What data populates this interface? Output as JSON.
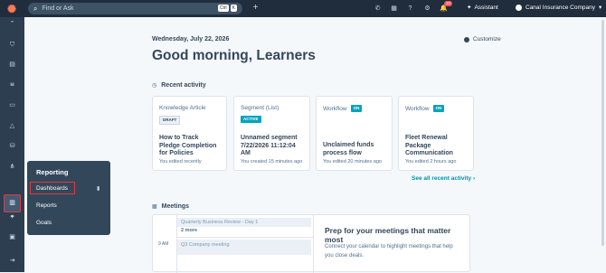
{
  "topbar": {
    "logo": "hubspot-logo",
    "search_placeholder": "Find or Ask",
    "shortcut_keys": [
      "Ctrl",
      "K"
    ],
    "notification_count": "20",
    "assistant_label": "Assistant",
    "account_name": "Canal Insurance Company"
  },
  "sidebar": {
    "icons": [
      "collapse-icon",
      "bookmark-icon",
      "contacts-icon",
      "marketing-icon",
      "sales-icon",
      "service-icon",
      "automation-icon",
      "data-icon",
      "content-icon",
      "reporting-icon",
      "divider",
      "ai-sparkle-icon",
      "library-icon",
      "expand-icon"
    ]
  },
  "flyout": {
    "title": "Reporting",
    "items": [
      "Dashboards",
      "Reports",
      "Goals"
    ]
  },
  "main": {
    "date": "Wednesday, July 22, 2026",
    "customize_label": "Customize",
    "greeting": "Good morning, Learners",
    "recent_activity_label": "Recent activity",
    "cards": [
      {
        "type": "Knowledge Article",
        "badge": "DRAFT",
        "title_lines": [
          "How to Track",
          "Pledge Completion",
          "for Policies"
        ],
        "sub": "You edited recently"
      },
      {
        "type": "Segment (List)",
        "badge": "ACTIVE",
        "title_lines": [
          "Unnamed segment",
          "7/22/2026 11:12:04",
          "AM"
        ],
        "sub": "You created 15 minutes ago"
      },
      {
        "type": "Workflow",
        "badge": "ON",
        "title_lines": [
          "Unclaimed funds",
          "process flow"
        ],
        "sub": "You edited 20 minutes ago"
      },
      {
        "type": "Workflow",
        "badge": "ON",
        "title_lines": [
          "Fleet Renewal",
          "Package",
          "Communication"
        ],
        "sub": "You edited 2 hours ago"
      }
    ],
    "see_all_label": "See all recent activity",
    "meetings_label": "Meetings",
    "meetings": {
      "event1": "Quarterly Business Review - Day 1",
      "more": "2 more",
      "time": "9 AM",
      "event2": "Q3 Company meeting",
      "prep_title": "Prep for your meetings that matter most",
      "prep_text": "Connect your calendar to highlight meetings that help you close deals."
    }
  },
  "colors": {
    "topbar": "#1f2d3d",
    "sidebar": "#2d3e50",
    "accent": "#00a4bd",
    "link": "#0091ae",
    "highlight": "#e03b3b"
  }
}
